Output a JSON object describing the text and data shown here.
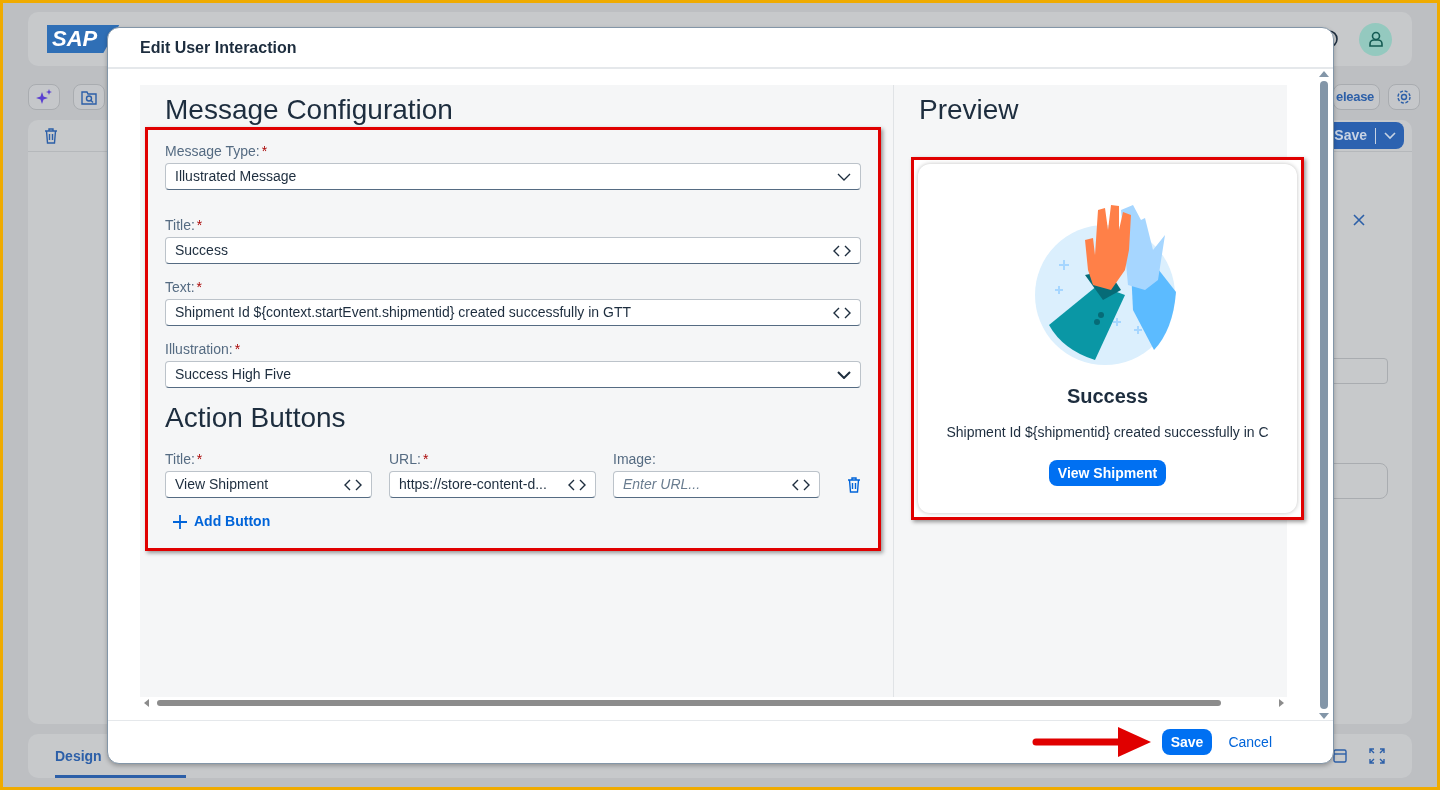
{
  "app": {
    "logo": "SAP",
    "release_button": "elease",
    "save_button": "Save",
    "bottom_tab": {
      "label": "Design",
      "selected": true
    }
  },
  "dialog": {
    "title": "Edit User Interaction",
    "config": {
      "heading": "Message Configuration",
      "fields": [
        {
          "label": "Message Type:",
          "required_mark": "*",
          "value": "Illustrated Message",
          "kind": "select"
        },
        {
          "label": "Title:",
          "required_mark": "*",
          "value": "Success",
          "kind": "expression"
        },
        {
          "label": "Text:",
          "required_mark": "*",
          "value": "Shipment Id ${context.startEvent.shipmentid} created successfully in GTT",
          "kind": "expression"
        },
        {
          "label": "Illustration:",
          "required_mark": "*",
          "value": "Success High Five",
          "kind": "select"
        }
      ]
    },
    "actions": {
      "heading": "Action Buttons",
      "columns": [
        {
          "label": "Title:",
          "required_mark": "*",
          "value": "View Shipment"
        },
        {
          "label": "URL:",
          "required_mark": "*",
          "value": "https://store-content-d..."
        },
        {
          "label": "Image:",
          "placeholder": "Enter URL..."
        }
      ],
      "add_button": "Add Button"
    },
    "preview": {
      "heading": "Preview",
      "title": "Success",
      "text": "Shipment Id ${shipmentid} created successfully in C",
      "button": "View Shipment"
    },
    "footer_buttons": [
      {
        "label": "Save",
        "kind": "emphasized"
      },
      {
        "label": "Cancel",
        "kind": "transparent"
      }
    ]
  }
}
